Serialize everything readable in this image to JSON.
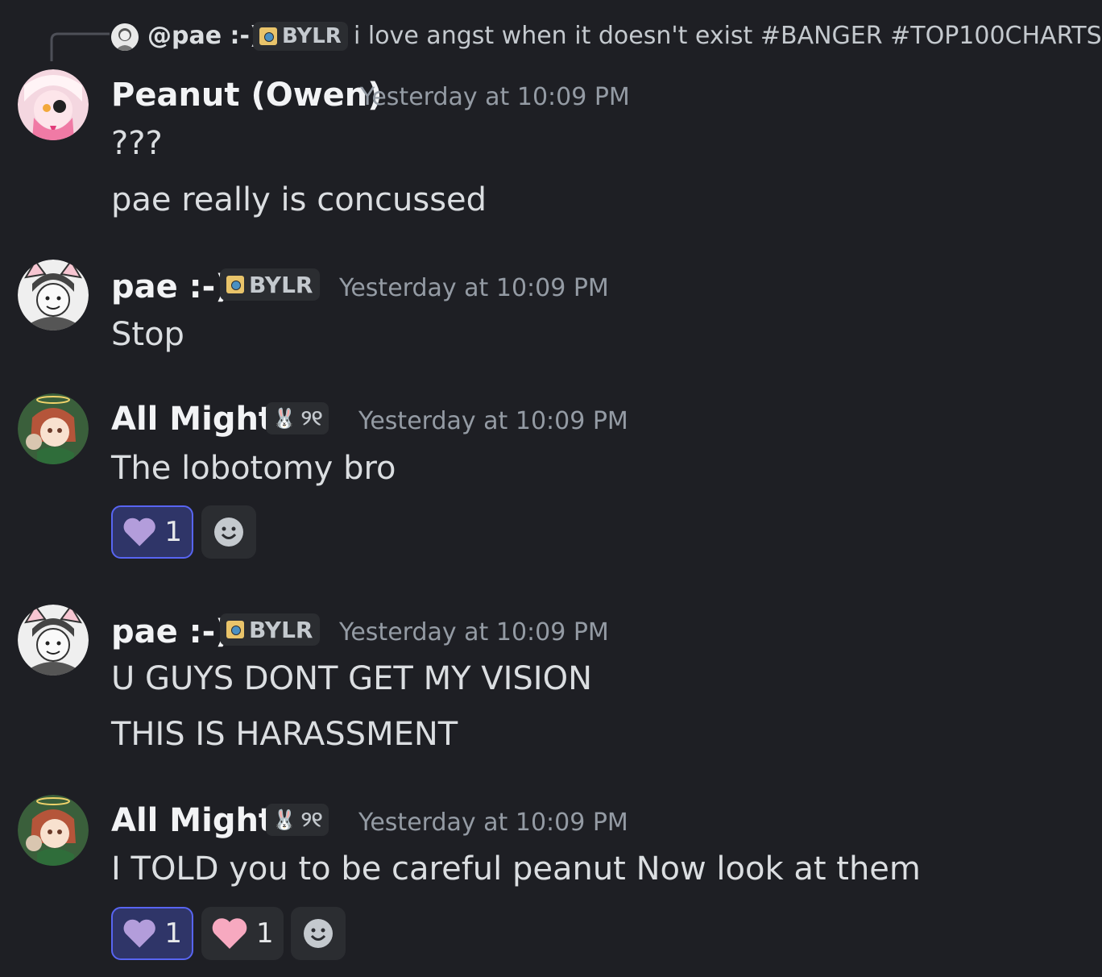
{
  "reply": {
    "author": "@pae :-)",
    "tag": "BYLR",
    "text": "i love angst when it doesn't exist #BANGER #TOP100CHARTS"
  },
  "messages": [
    {
      "author": "Peanut (Owen)",
      "timestamp": "Yesterday at 10:09 PM",
      "lines": [
        "???",
        "pae really is concussed"
      ]
    },
    {
      "author": "pae :-)",
      "tag": "BYLR",
      "timestamp": "Yesterday at 10:09 PM",
      "lines": [
        "Stop"
      ]
    },
    {
      "author": "All Might",
      "tag_glyph": "୨୧",
      "timestamp": "Yesterday at 10:09 PM",
      "lines": [
        "The lobotomy bro"
      ],
      "reactions": [
        {
          "emoji": "purple-heart",
          "count": "1",
          "color": "#b39ddb"
        }
      ]
    },
    {
      "author": "pae :-)",
      "tag": "BYLR",
      "timestamp": "Yesterday at 10:09 PM",
      "lines": [
        "U GUYS DONT GET MY VISION",
        "THIS IS HARASSMENT"
      ]
    },
    {
      "author": "All Might",
      "tag_glyph": "୨୧",
      "timestamp": "Yesterday at 10:09 PM",
      "lines": [
        "I TOLD you to be careful peanut Now look at them"
      ],
      "reactions": [
        {
          "emoji": "purple-heart",
          "count": "1",
          "color": "#b39ddb"
        },
        {
          "emoji": "pink-heart",
          "count": "1",
          "color": "#f7a9c0"
        }
      ]
    }
  ],
  "colors": {
    "background": "#1e1f24",
    "accent": "#5865f2",
    "muted": "#949ba4"
  }
}
